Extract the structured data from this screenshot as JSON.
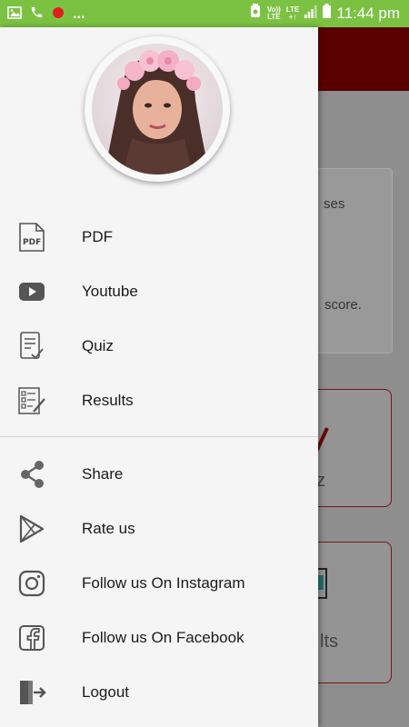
{
  "status_bar": {
    "time": "11:44 pm",
    "network_top": "Vo))",
    "network_bottom": "LTE",
    "lte_top": "LTE",
    "lte_bottom": "+↑",
    "overflow": "...",
    "icons": [
      "image-icon",
      "phone-icon",
      "record-icon",
      "alarm-icon",
      "signal-icon",
      "battery-icon"
    ]
  },
  "background_app": {
    "card_text_1": "ses",
    "card_text_2": "score.",
    "tile_1_label": "z",
    "tile_2_label": "lts"
  },
  "drawer": {
    "profile_icon": "profile-avatar",
    "primary_items": [
      {
        "label": "PDF",
        "icon": "pdf-icon"
      },
      {
        "label": "Youtube",
        "icon": "youtube-icon"
      },
      {
        "label": "Quiz",
        "icon": "quiz-icon"
      },
      {
        "label": "Results",
        "icon": "results-icon"
      }
    ],
    "secondary_items": [
      {
        "label": "Share",
        "icon": "share-icon"
      },
      {
        "label": "Rate us",
        "icon": "play-store-icon"
      },
      {
        "label": "Follow us On Instagram",
        "icon": "instagram-icon"
      },
      {
        "label": "Follow us On Facebook",
        "icon": "facebook-icon"
      },
      {
        "label": "Logout",
        "icon": "logout-icon"
      }
    ]
  },
  "colors": {
    "status_bar": "#7cc242",
    "app_bar": "#8b0000",
    "drawer_bg": "#f5f5f5",
    "icon_grey": "#6b6b6b"
  }
}
